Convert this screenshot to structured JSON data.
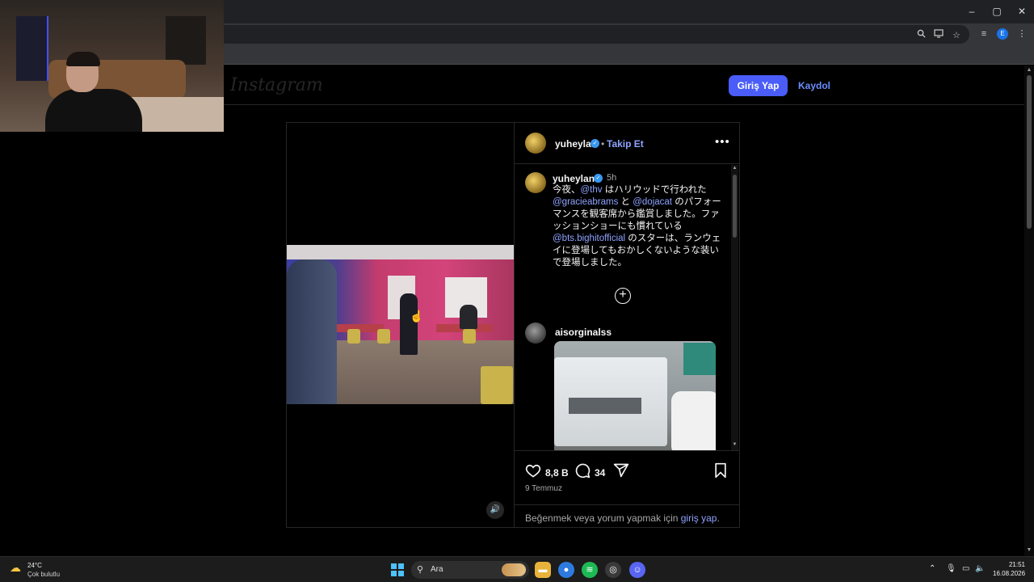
{
  "browser": {
    "window_controls": {
      "minimize": "–",
      "maximize": "▢",
      "close": "✕"
    },
    "toolbar_icons": [
      "zoom-icon",
      "cast-icon",
      "star-icon",
      "reading-list-icon",
      "menu-icon"
    ],
    "profile_initial": "E"
  },
  "instagram": {
    "logo": "Instagram",
    "login_button": "Giriş Yap",
    "signup_link": "Kaydol"
  },
  "post": {
    "author": "yuheylan",
    "follow_separator": "•",
    "follow_label": "Takip Et",
    "more_label": "•••",
    "caption": {
      "author": "yuheylan",
      "time": "5h",
      "parts": {
        "p1": "今夜、",
        "m1": "@thv",
        "p2": " はハリウッドで行われた",
        "m2": "@gracieabrams",
        "p3": " と ",
        "m3": "@dojacat",
        "p4": " のパフォーマンスを観客席から鑑賞しました。ファッションショーにも慣れている",
        "m4": "@bts.bighitofficial",
        "p5": " のスターは、ランウェイに登場してもおかしくないような装いで登場しました。"
      }
    },
    "load_more_label": "+",
    "comment": {
      "user": "aisorginalss"
    },
    "likes": "8,8 B",
    "comments_count": "34",
    "date": "9 Temmuz",
    "login_prompt": {
      "text": "Beğenmek veya yorum yapmak için ",
      "link": "giriş yap",
      "suffix": "."
    }
  },
  "taskbar": {
    "weather_temp": "24°C",
    "weather_cond": "Çok bulutlu",
    "search_placeholder": "Ara",
    "time": "21:51",
    "date": "16.08.2026"
  }
}
